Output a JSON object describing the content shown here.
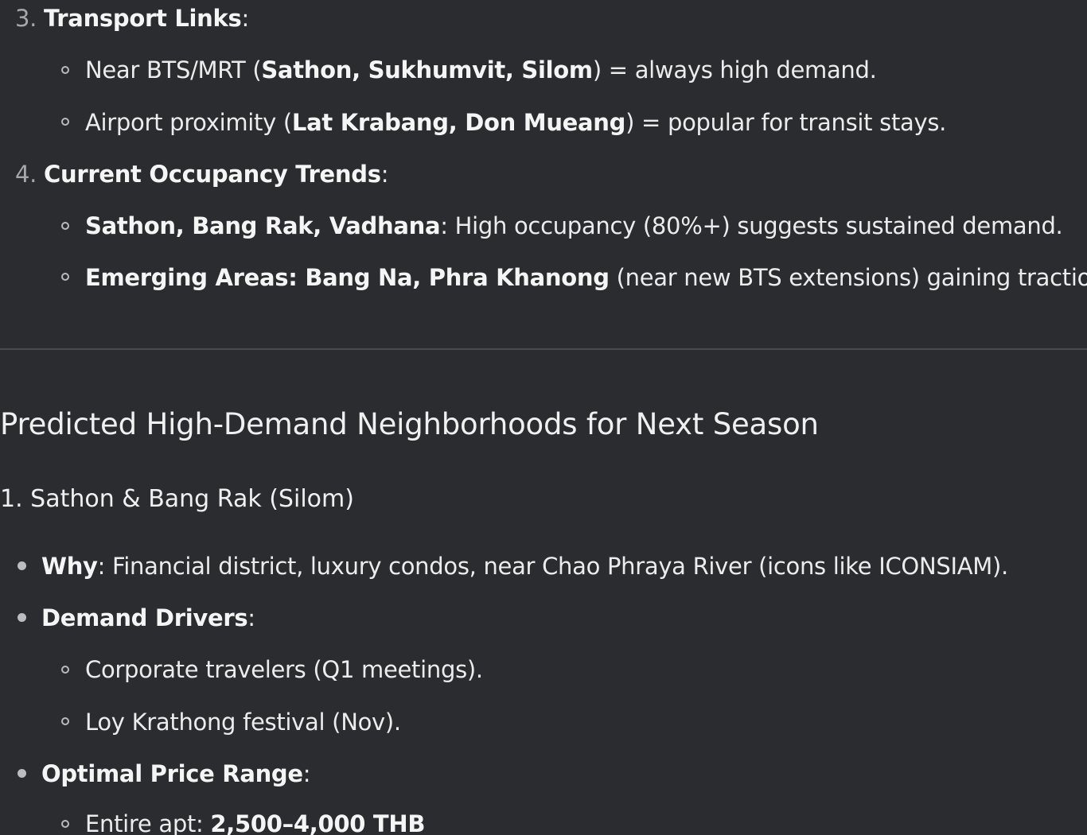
{
  "section_a": {
    "item3": {
      "num": "3.",
      "label": "Transport Links",
      "suffix": ":",
      "bullets": [
        {
          "pre": "Near BTS/MRT (",
          "bold": "Sathon, Sukhumvit, Silom",
          "post": ") = always high demand."
        },
        {
          "pre": "Airport proximity (",
          "bold": "Lat Krabang, Don Mueang",
          "post": ") = popular for transit stays."
        }
      ]
    },
    "item4": {
      "num": "4.",
      "label": "Current Occupancy Trends",
      "suffix": ":",
      "bullets": [
        {
          "bold": "Sathon, Bang Rak, Vadhana",
          "post": ": High occupancy (80%+) suggests sustained demand."
        },
        {
          "bold": "Emerging Areas: Bang Na, Phra Khanong",
          "post": " (near new BTS extensions) gaining traction."
        }
      ]
    }
  },
  "section_b": {
    "heading": "Predicted High-Demand Neighborhoods for Next Season",
    "subheading": "1. Sathon & Bang Rak (Silom)",
    "why": {
      "bold": "Why",
      "post": ": Financial district, luxury condos, near Chao Phraya River (icons like ICONSIAM)."
    },
    "drivers": {
      "bold": "Demand Drivers",
      "post": ":",
      "bullets": [
        "Corporate travelers (Q1 meetings).",
        "Loy Krathong festival (Nov)."
      ]
    },
    "price": {
      "bold": "Optimal Price Range",
      "post": ":",
      "bullets": [
        {
          "pre": "Entire apt: ",
          "bold": "2,500–4,000 THB"
        }
      ]
    }
  }
}
